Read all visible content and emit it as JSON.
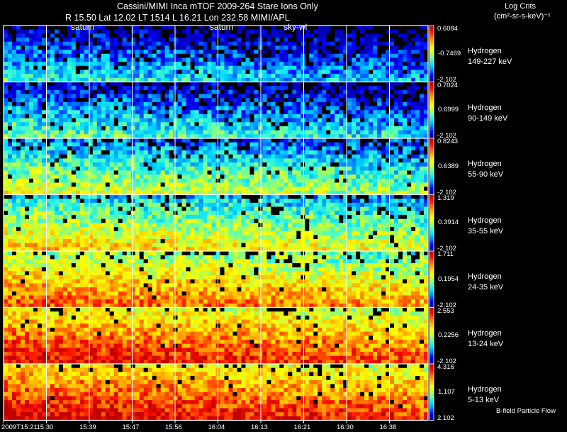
{
  "header": {
    "line1": "Cassini/MIMI Inca mTOF  2009-264   Stare   Ions Only",
    "line2": "R      15.50 Lat 12.02 LT 1514 L      16.21 Lon     232.58  MIMI/APL"
  },
  "units": {
    "title": "Log Cnts",
    "subtitle": "(cm²-sr-s-keV)⁻¹"
  },
  "markers": [
    "saturn",
    "saturn",
    "sky-wl"
  ],
  "footer_note": "B-field Particle Flow",
  "colors": {
    "background": "#000000",
    "grid": "#ffffff",
    "colormap": [
      "#0000b4",
      "#0000ff",
      "#0080ff",
      "#00e0ff",
      "#50ffc0",
      "#c0ff40",
      "#ffff00",
      "#ffc000",
      "#ff7000",
      "#ff1000",
      "#c00000"
    ]
  },
  "chart_data": {
    "type": "heatmap",
    "x_axis": {
      "ticks": [
        "2009T15:21",
        "15:30",
        "15:39",
        "15:47",
        "15:56",
        "16:04",
        "16:13",
        "16:21",
        "16:30",
        "16:38"
      ],
      "range": [
        "15:21",
        "16:43"
      ]
    },
    "panels": [
      {
        "species": "Hydrogen",
        "energy": "149-227 keV",
        "cmax": "0.6084",
        "cmid": "-0.7469",
        "cmin": "-2.102",
        "level": 0.2,
        "dropout": 0.35
      },
      {
        "species": "Hydrogen",
        "energy": "90-149 keV",
        "cmax": "0.7024",
        "cmid": "0.6999",
        "cmin": "-2.102",
        "level": 0.27,
        "dropout": 0.25
      },
      {
        "species": "Hydrogen",
        "energy": "55-90 keV",
        "cmax": "0.8243",
        "cmid": "0.6389",
        "cmin": "-2.102",
        "level": 0.42,
        "dropout": 0.15
      },
      {
        "species": "Hydrogen",
        "energy": "35-55 keV",
        "cmax": "1.319",
        "cmid": "0.3914",
        "cmin": "-2.102",
        "level": 0.52,
        "dropout": 0.1
      },
      {
        "species": "Hydrogen",
        "energy": "24-35 keV",
        "cmax": "1.711",
        "cmid": "0.1954",
        "cmin": "-2.102",
        "level": 0.68,
        "dropout": 0.08
      },
      {
        "species": "Hydrogen",
        "energy": "13-24 keV",
        "cmax": "2.553",
        "cmid": "0.2256",
        "cmin": "-2.102",
        "level": 0.8,
        "dropout": 0.06
      },
      {
        "species": "Hydrogen",
        "energy": "5-13 keV",
        "cmax": "4.316",
        "cmid": "1.107",
        "cmin": "2.102",
        "level": 0.83,
        "dropout": 0.05
      }
    ]
  }
}
